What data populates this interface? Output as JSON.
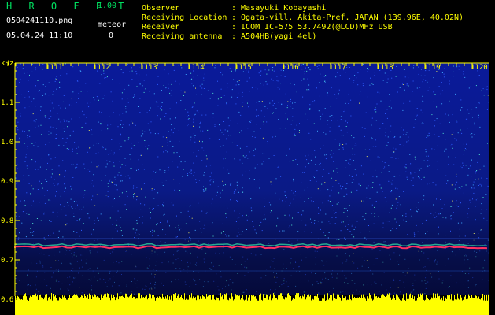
{
  "header": {
    "app_title": "H R O F F T",
    "app_version": "1.00",
    "file_name": "0504241110.png",
    "meteor_label": "meteor",
    "date_time": "05.04.24 11:10",
    "meteor_count": "0"
  },
  "station_info": [
    {
      "label": "Observer",
      "value": ": Masayuki Kobayashi"
    },
    {
      "label": "Receiving Location",
      "value": ": Ogata-vill. Akita-Pref. JAPAN (139.96E, 40.02N)"
    },
    {
      "label": "Receiver",
      "value": ": ICOM IC-575 53.7492(@LCD)MHz USB"
    },
    {
      "label": "Receiving antenna",
      "value": ": A504HB(yagi 4el)"
    }
  ],
  "spectrogram": {
    "y_unit": "kHz",
    "y_ticks": [
      "1.1",
      "1.0",
      "0.9",
      "0.8",
      "0.7",
      "0.6"
    ],
    "time_ticks": [
      "1111",
      "1112",
      "1113",
      "1114",
      "1115",
      "1116",
      "1117",
      "1118",
      "1119",
      "1120"
    ],
    "background_color": "#0a1a8c",
    "axis_color": "#ffff00",
    "signal_color": "#ff3060",
    "noise_bar_color": "#ffff00"
  }
}
